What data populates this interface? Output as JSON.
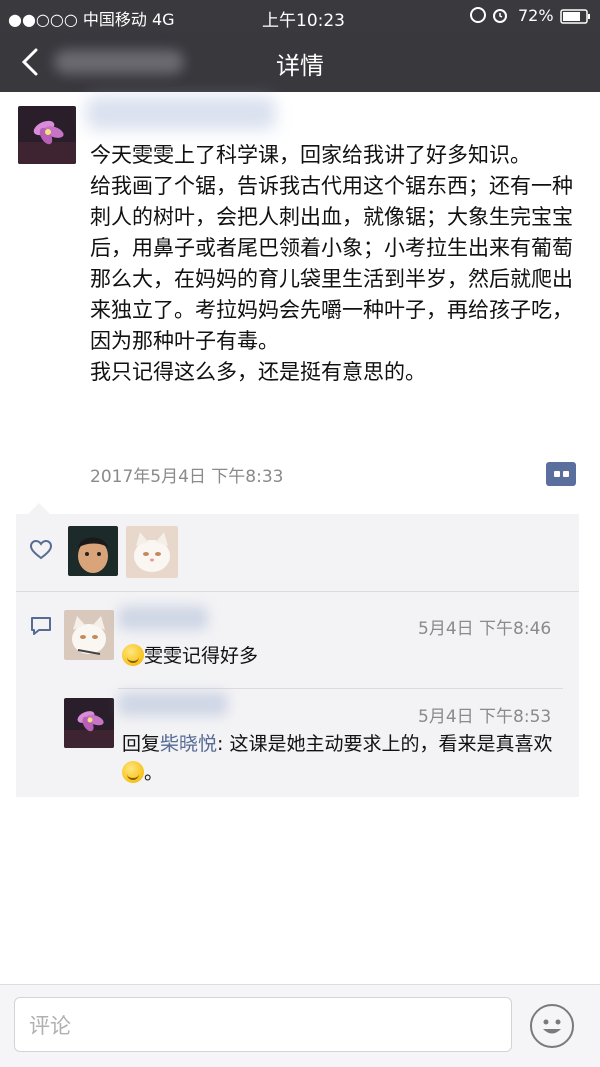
{
  "status_bar": {
    "carrier": "●●○○○ 中国移动  4G",
    "time": "上午10:23",
    "battery": "72%"
  },
  "nav": {
    "title": "详情",
    "back_icon": "chevron-left-icon"
  },
  "post": {
    "lines": [
      "今天雯雯上了科学课，回家给我讲了好多知识。",
      "给我画了个锯，告诉我古代用这个锯东西；还有一种刺人的树叶，会把人刺出血，就像锯；大象生完宝宝后，用鼻子或者尾巴领着小象；小考拉生出来有葡萄那么大，在妈妈的育儿袋里生活到半岁，然后就爬出来独立了。考拉妈妈会先嚼一种叶子，再给孩子吃，因为那种叶子有毒。",
      "我只记得这么多，还是挺有意思的。"
    ],
    "timestamp": "2017年5月4日 下午8:33"
  },
  "comments": [
    {
      "time": "5月4日 下午8:46",
      "text": "雯雯记得好多"
    },
    {
      "time": "5月4日 下午8:53",
      "reply_prefix": "回复",
      "reply_to": "柴晓悦",
      "text": ": 这课是她主动要求上的，看来是真喜欢"
    }
  ],
  "input": {
    "placeholder": "评论"
  },
  "colors": {
    "nav_bg": "#39383d",
    "link": "#576b95",
    "feedback_bg": "#f3f3f5"
  }
}
